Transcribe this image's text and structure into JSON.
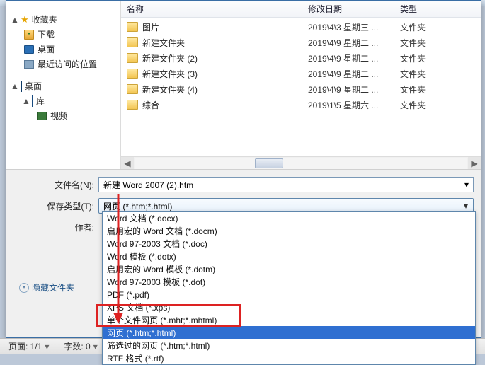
{
  "tree": {
    "favorites": {
      "label": "收藏夹",
      "items": [
        "下载",
        "桌面",
        "最近访问的位置"
      ]
    },
    "desktop": {
      "label": "桌面"
    },
    "libraries": {
      "label": "库",
      "items": [
        "视频"
      ]
    }
  },
  "columns": {
    "name": "名称",
    "date": "修改日期",
    "type": "类型"
  },
  "files": [
    {
      "name": "图片",
      "date": "2019\\4\\3 星期三 ...",
      "type": "文件夹"
    },
    {
      "name": "新建文件夹",
      "date": "2019\\4\\9 星期二 ...",
      "type": "文件夹"
    },
    {
      "name": "新建文件夹 (2)",
      "date": "2019\\4\\9 星期二 ...",
      "type": "文件夹"
    },
    {
      "name": "新建文件夹 (3)",
      "date": "2019\\4\\9 星期二 ...",
      "type": "文件夹"
    },
    {
      "name": "新建文件夹 (4)",
      "date": "2019\\4\\9 星期二 ...",
      "type": "文件夹"
    },
    {
      "name": "综合",
      "date": "2019\\1\\5 星期六 ...",
      "type": "文件夹"
    }
  ],
  "form": {
    "filename_label": "文件名(N):",
    "filename_value": "新建 Word 2007 (2).htm",
    "savetype_label": "保存类型(T):",
    "savetype_value": "网页 (*.htm;*.html)",
    "author_label": "作者:"
  },
  "dropdown": [
    "Word 文档 (*.docx)",
    "启用宏的 Word 文档 (*.docm)",
    "Word 97-2003 文档 (*.doc)",
    "Word 模板 (*.dotx)",
    "启用宏的 Word 模板 (*.dotm)",
    "Word 97-2003 模板 (*.dot)",
    "PDF (*.pdf)",
    "XPS 文档 (*.xps)",
    "单个文件网页 (*.mht;*.mhtml)",
    "网页 (*.htm;*.html)",
    "筛选过的网页 (*.htm;*.html)",
    "RTF 格式 (*.rtf)"
  ],
  "hidefolders": "隐藏文件夹",
  "status": {
    "page": "页面: 1/1",
    "words": "字数: 0"
  }
}
